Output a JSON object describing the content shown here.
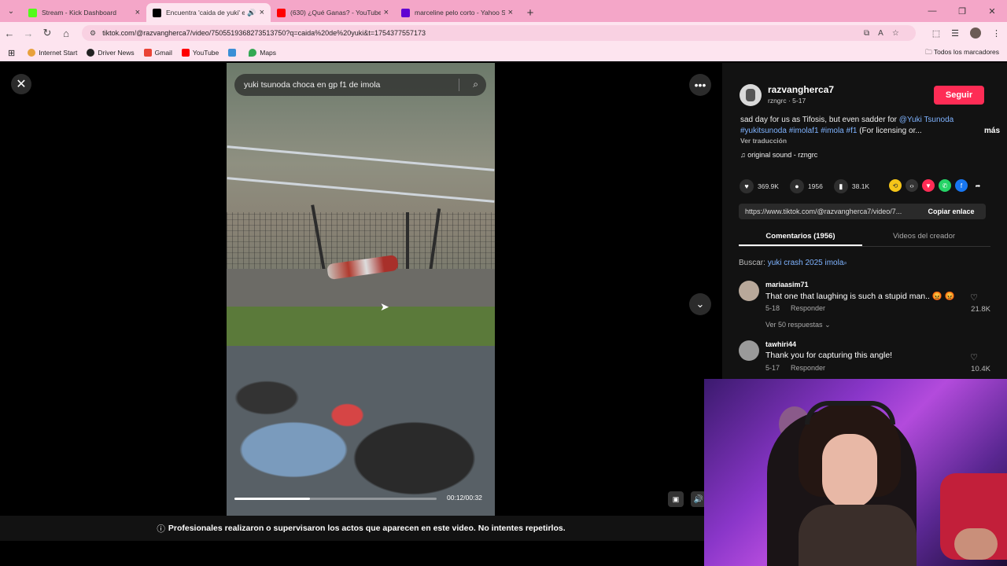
{
  "browser": {
    "tabs": [
      {
        "label": "Stream - Kick Dashboard",
        "color": "#53fc18",
        "active": false
      },
      {
        "label": "Encuentra 'caida de yuki' en",
        "color": "#000000",
        "active": true
      },
      {
        "label": "(630) ¿Qué Ganas? - YouTube",
        "color": "#ff0000",
        "active": false
      },
      {
        "label": "marceline pelo corto - Yahoo S",
        "color": "#6001d2",
        "active": false
      }
    ],
    "url": "tiktok.com/@razvangherca7/video/7505519368273513750?q=caida%20de%20yuki&t=1754377557173",
    "bookmarks": [
      {
        "label": "Internet Start",
        "color": "#e8a13c"
      },
      {
        "label": "Driver News",
        "color": "#222222"
      },
      {
        "label": "Gmail",
        "color": "#ea4335"
      },
      {
        "label": "YouTube",
        "color": "#ff0000"
      },
      {
        "label": "",
        "color": "#3b8fd6"
      },
      {
        "label": "Maps",
        "color": "#34a853"
      }
    ],
    "all_bookmarks": "Todos los marcadores"
  },
  "video": {
    "search_query": "yuki tsunoda choca en gp f1 de imola",
    "time": "00:12/00:32",
    "progress": 0.375,
    "disclaimer": "Profesionales realizaron o supervisaron los actos que aparecen en este video. No intentes repetirlos."
  },
  "post": {
    "username": "razvangherca7",
    "subline": "rzngrc · 5-17",
    "follow_label": "Seguir",
    "desc_text": "sad day for us as Tifosis, but even sadder for ",
    "desc_mention": "@Yuki Tsunoda",
    "desc_tags": "#yukitsunoda #imolaf1 #imola #f1",
    "desc_rest": " (For licensing or...",
    "more_label": "más",
    "translate_label": "Ver traducción",
    "sound": "original sound - rzngrc",
    "likes": "369.9K",
    "comments_count": "1956",
    "saves": "38.1K",
    "share_link": "https://www.tiktok.com/@razvangherca7/video/7...",
    "copy_label": "Copiar enlace",
    "tab_comments": "Comentarios (1956)",
    "tab_videos": "Videos del creador",
    "search_prefix": "Buscar: ",
    "search_suggestion": "yuki crash 2025 imola"
  },
  "comments": [
    {
      "user": "mariaasim71",
      "text": "That one that laughing is such a stupid man.. 😡 😡",
      "date": "5-18",
      "reply": "Responder",
      "likes": "21.8K"
    },
    {
      "user": "tawhiri44",
      "text": "Thank you for capturing this angle!",
      "date": "5-17",
      "reply": "Responder",
      "likes": "10.4K"
    }
  ],
  "more_replies": "Ver 50 respuestas"
}
